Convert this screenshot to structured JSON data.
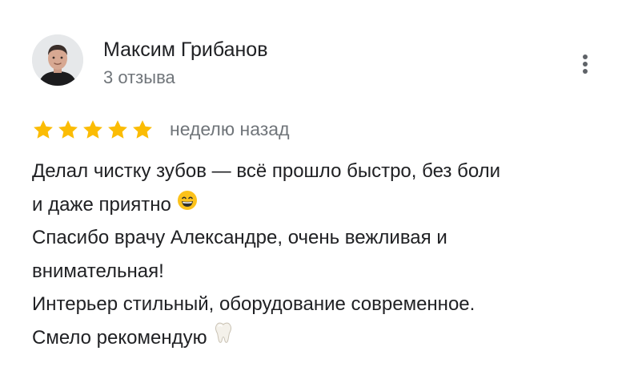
{
  "author": {
    "name": "Максим Грибанов",
    "review_count": "3 отзыва",
    "avatar_icon": "person-photo"
  },
  "review": {
    "rating": 5,
    "rating_max": 5,
    "date": "неделю назад",
    "lines": [
      "Делал чистку зубов — всё прошло быстро, без боли",
      "и даже приятно",
      "Спасибо врачу Александре, очень вежливая и",
      "внимательная!",
      "Интерьер стильный, оборудование современное.",
      "Смело рекомендую"
    ],
    "emojis": {
      "line_2": "grinning-face-emoji",
      "line_6": "tooth-emoji"
    }
  },
  "menu": {
    "icon": "more-vertical-icon"
  },
  "colors": {
    "star": "#fbbc04",
    "secondary_text": "#70757a",
    "primary_text": "#202124"
  }
}
